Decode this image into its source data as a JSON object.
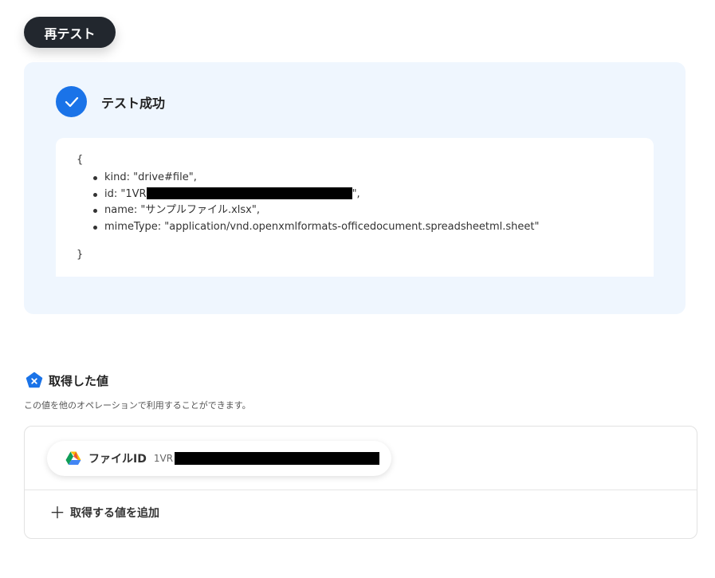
{
  "retest_button": {
    "label": "再テスト"
  },
  "result": {
    "title": "テスト成功",
    "brace_open": "{",
    "brace_close": "}",
    "fields": [
      {
        "text": "kind: \"drive#file\","
      },
      {
        "prefix": "id: \"1VR",
        "suffix": "\","
      },
      {
        "text": "name: \"サンプルファイル.xlsx\","
      },
      {
        "text": "mimeType: \"application/vnd.openxmlformats-officedocument.spreadsheetml.sheet\""
      }
    ]
  },
  "acquired": {
    "title": "取得した値",
    "description": "この値を他のオペレーションで利用することができます。",
    "chip": {
      "label": "ファイルID",
      "value_prefix": "1VR"
    },
    "add_label": "取得する値を追加"
  },
  "colors": {
    "accent": "#1a73e8",
    "panel_bg": "#eff6fe",
    "dark_button": "#22272e"
  },
  "icons": {
    "success": "check-icon",
    "section": "pentagon-x-icon",
    "chip": "google-drive-icon",
    "add": "plus-icon"
  }
}
